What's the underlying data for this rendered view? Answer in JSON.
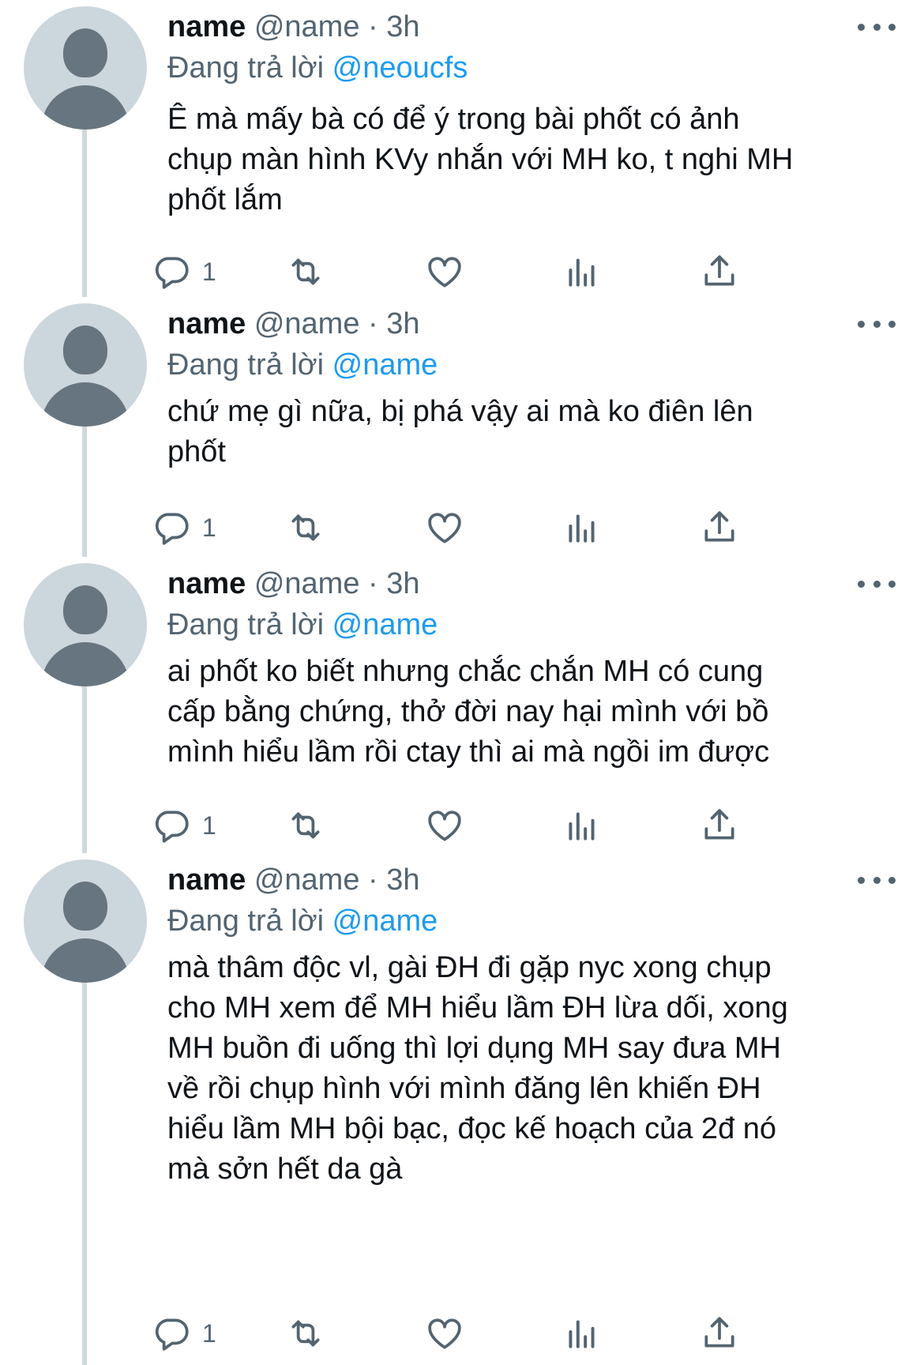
{
  "tweets": [
    {
      "name": "name",
      "meta": "@name · 3h",
      "reply_prefix": "Đang trả lời",
      "reply_to": "@neoucfs",
      "text": "Ê mà mấy bà có để ý trong bài phốt có ảnh\nchụp màn hình KVy nhắn với MH ko, t nghi MH\nphốt lắm",
      "reply_count": "1"
    },
    {
      "name": "name",
      "meta": "@name · 3h",
      "reply_prefix": "Đang trả lời",
      "reply_to": "@name",
      "text": "chứ mẹ gì nữa, bị phá vậy ai mà ko điên lên\nphốt",
      "reply_count": "1"
    },
    {
      "name": "name",
      "meta": "@name · 3h",
      "reply_prefix": "Đang trả lời",
      "reply_to": "@name",
      "text": "ai phốt ko biết nhưng chắc chắn MH có cung\ncấp bằng chứng, thở đời nay hại mình với bồ\nmình hiểu lầm rồi ctay thì ai mà ngồi im được",
      "reply_count": "1"
    },
    {
      "name": "name",
      "meta": "@name · 3h",
      "reply_prefix": "Đang trả lời",
      "reply_to": "@name",
      "text": "mà thâm độc vl, gài ĐH đi gặp nyc xong chụp\ncho MH xem để MH hiểu lầm ĐH lừa dối, xong\nMH buồn đi uống thì lợi dụng MH say đưa MH\nvề rồi chụp hình với mình đăng lên khiến ĐH\nhiểu lầm MH bội bạc, đọc kế hoạch của 2đ nó\nmà sởn hết da gà",
      "reply_count": "1"
    }
  ],
  "icons": {
    "reply": "reply-icon",
    "retweet": "retweet-icon",
    "like": "heart-icon",
    "views": "analytics-icon",
    "share": "share-icon",
    "more": "more-icon",
    "avatar": "default-avatar"
  },
  "colors": {
    "text": "#0f1419",
    "secondary": "#536471",
    "mention": "#1d9bf0",
    "thread_line": "#cfd9de",
    "avatar_bg": "#ccd6dd",
    "avatar_fg": "#66757f"
  }
}
